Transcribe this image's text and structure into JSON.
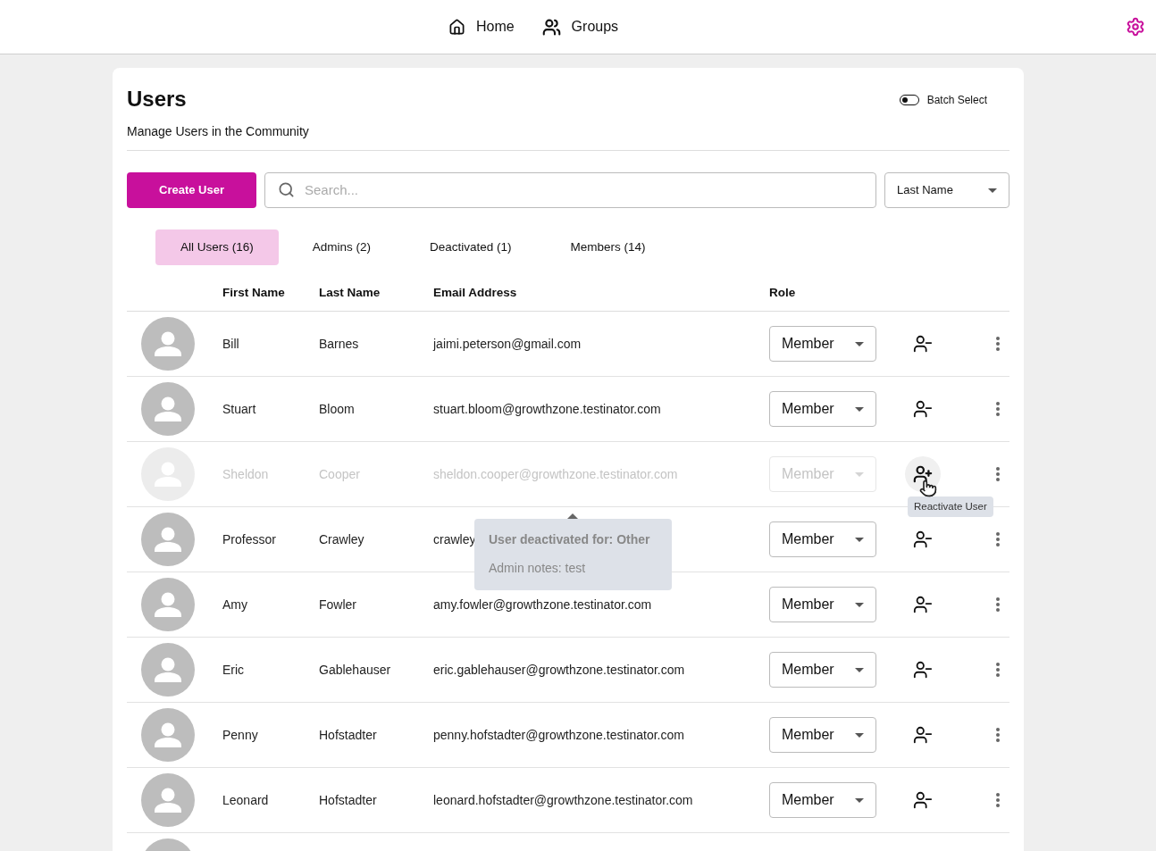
{
  "nav": [
    {
      "label": "Home",
      "kind": "home"
    },
    {
      "label": "Groups",
      "kind": "groups"
    }
  ],
  "page": {
    "title": "Users",
    "subtitle": "Manage Users in the Community",
    "batch_select": {
      "label": "Batch Select",
      "on": false
    }
  },
  "create_button": "Create User",
  "search": {
    "placeholder": "Search..."
  },
  "sort": {
    "value": "Last Name"
  },
  "tabs": [
    {
      "label": "All Users (16)",
      "selected": true
    },
    {
      "label": "Admins (2)",
      "selected": false
    },
    {
      "label": "Deactivated (1)",
      "selected": false
    },
    {
      "label": "Members (14)",
      "selected": false
    }
  ],
  "columns": [
    "First Name",
    "Last Name",
    "Email Address",
    "Role"
  ],
  "rows": [
    {
      "first": "Bill",
      "last": "Barnes",
      "email": "jaimi.peterson@gmail.com",
      "role": "Member",
      "deactivated": false
    },
    {
      "first": "Stuart",
      "last": "Bloom",
      "email": "stuart.bloom@growthzone.testinator.com",
      "role": "Member",
      "deactivated": false
    },
    {
      "first": "Sheldon",
      "last": "Cooper",
      "email": "sheldon.cooper@growthzone.testinator.com",
      "role": "Member",
      "deactivated": true,
      "action_tooltip": "Reactivate User",
      "deactivation_info": {
        "reason": "User deactivated for: Other",
        "notes": "Admin notes: test"
      }
    },
    {
      "first": "Professor",
      "last": "Crawley",
      "email": "crawley",
      "role": "Member",
      "deactivated": false
    },
    {
      "first": "Amy",
      "last": "Fowler",
      "email": "amy.fowler@growthzone.testinator.com",
      "role": "Member",
      "deactivated": false
    },
    {
      "first": "Eric",
      "last": "Gablehauser",
      "email": "eric.gablehauser@growthzone.testinator.com",
      "role": "Member",
      "deactivated": false
    },
    {
      "first": "Penny",
      "last": "Hofstadter",
      "email": "penny.hofstadter@growthzone.testinator.com",
      "role": "Member",
      "deactivated": false
    },
    {
      "first": "Leonard",
      "last": "Hofstadter",
      "email": "leonard.hofstadter@growthzone.testinator.com",
      "role": "Member",
      "deactivated": false
    },
    {
      "deactivated": false
    }
  ]
}
